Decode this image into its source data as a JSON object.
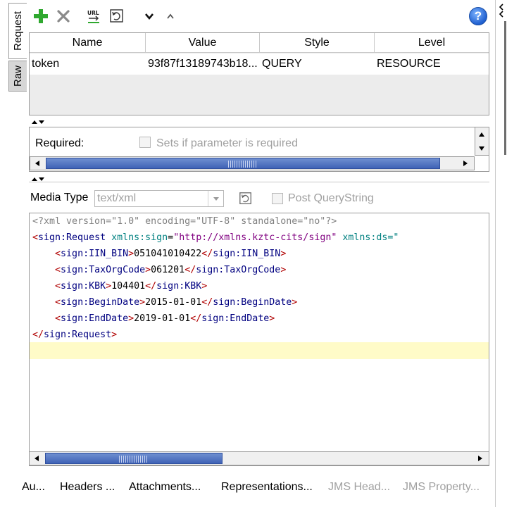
{
  "side_tabs": [
    {
      "label": "Request",
      "active": true
    },
    {
      "label": "Raw",
      "active": false
    }
  ],
  "toolbar": {
    "add_icon": "plus-icon",
    "remove_icon": "x-icon",
    "url_icon": "url-encode-icon",
    "extract_icon": "extract-params-icon",
    "move_down_icon": "chevron-down-icon",
    "move_up_icon": "chevron-up-icon",
    "help_label": "?",
    "url_text": "URL"
  },
  "params_table": {
    "columns": [
      "Name",
      "Value",
      "Style",
      "Level"
    ],
    "rows": [
      {
        "name": "token",
        "value": "93f87f13189743b18...",
        "style": "QUERY",
        "level": "RESOURCE"
      }
    ]
  },
  "details": {
    "required_label": "Required:",
    "required_checkbox_label": "Sets if parameter is required"
  },
  "media": {
    "label": "Media Type",
    "value": "text/xml",
    "post_querystring_label": "Post QueryString"
  },
  "editor": {
    "line1": "<?xml version=\"1.0\" encoding=\"UTF-8\" standalone=\"no\"?>",
    "root_open_tag": "sign:Request",
    "root_attr1_name": "xmlns:sign",
    "root_attr1_value": "\"http://xmlns.kztc-cits/sign\"",
    "root_attr2_name": "xmlns:ds=\"",
    "elements": [
      {
        "tag": "sign:IIN_BIN",
        "value": "051041010422"
      },
      {
        "tag": "sign:TaxOrgCode",
        "value": "061201"
      },
      {
        "tag": "sign:KBK",
        "value": "104401"
      },
      {
        "tag": "sign:BeginDate",
        "value": "2015-01-01"
      },
      {
        "tag": "sign:EndDate",
        "value": "2019-01-01"
      }
    ],
    "root_close_tag": "sign:Request"
  },
  "bottom_tabs": [
    {
      "label": "Au...",
      "enabled": true
    },
    {
      "label": "Headers ...",
      "enabled": true
    },
    {
      "label": "Attachments...",
      "enabled": true
    },
    {
      "label": "Representations...",
      "enabled": true
    },
    {
      "label": "JMS Head...",
      "enabled": false
    },
    {
      "label": "JMS Property...",
      "enabled": false
    }
  ],
  "colors": {
    "add_green": "#2fa82f",
    "remove_gray": "#8a8a8a",
    "scroll_thumb": "#4a6cc0",
    "highlight_line": "#fffbc8"
  }
}
